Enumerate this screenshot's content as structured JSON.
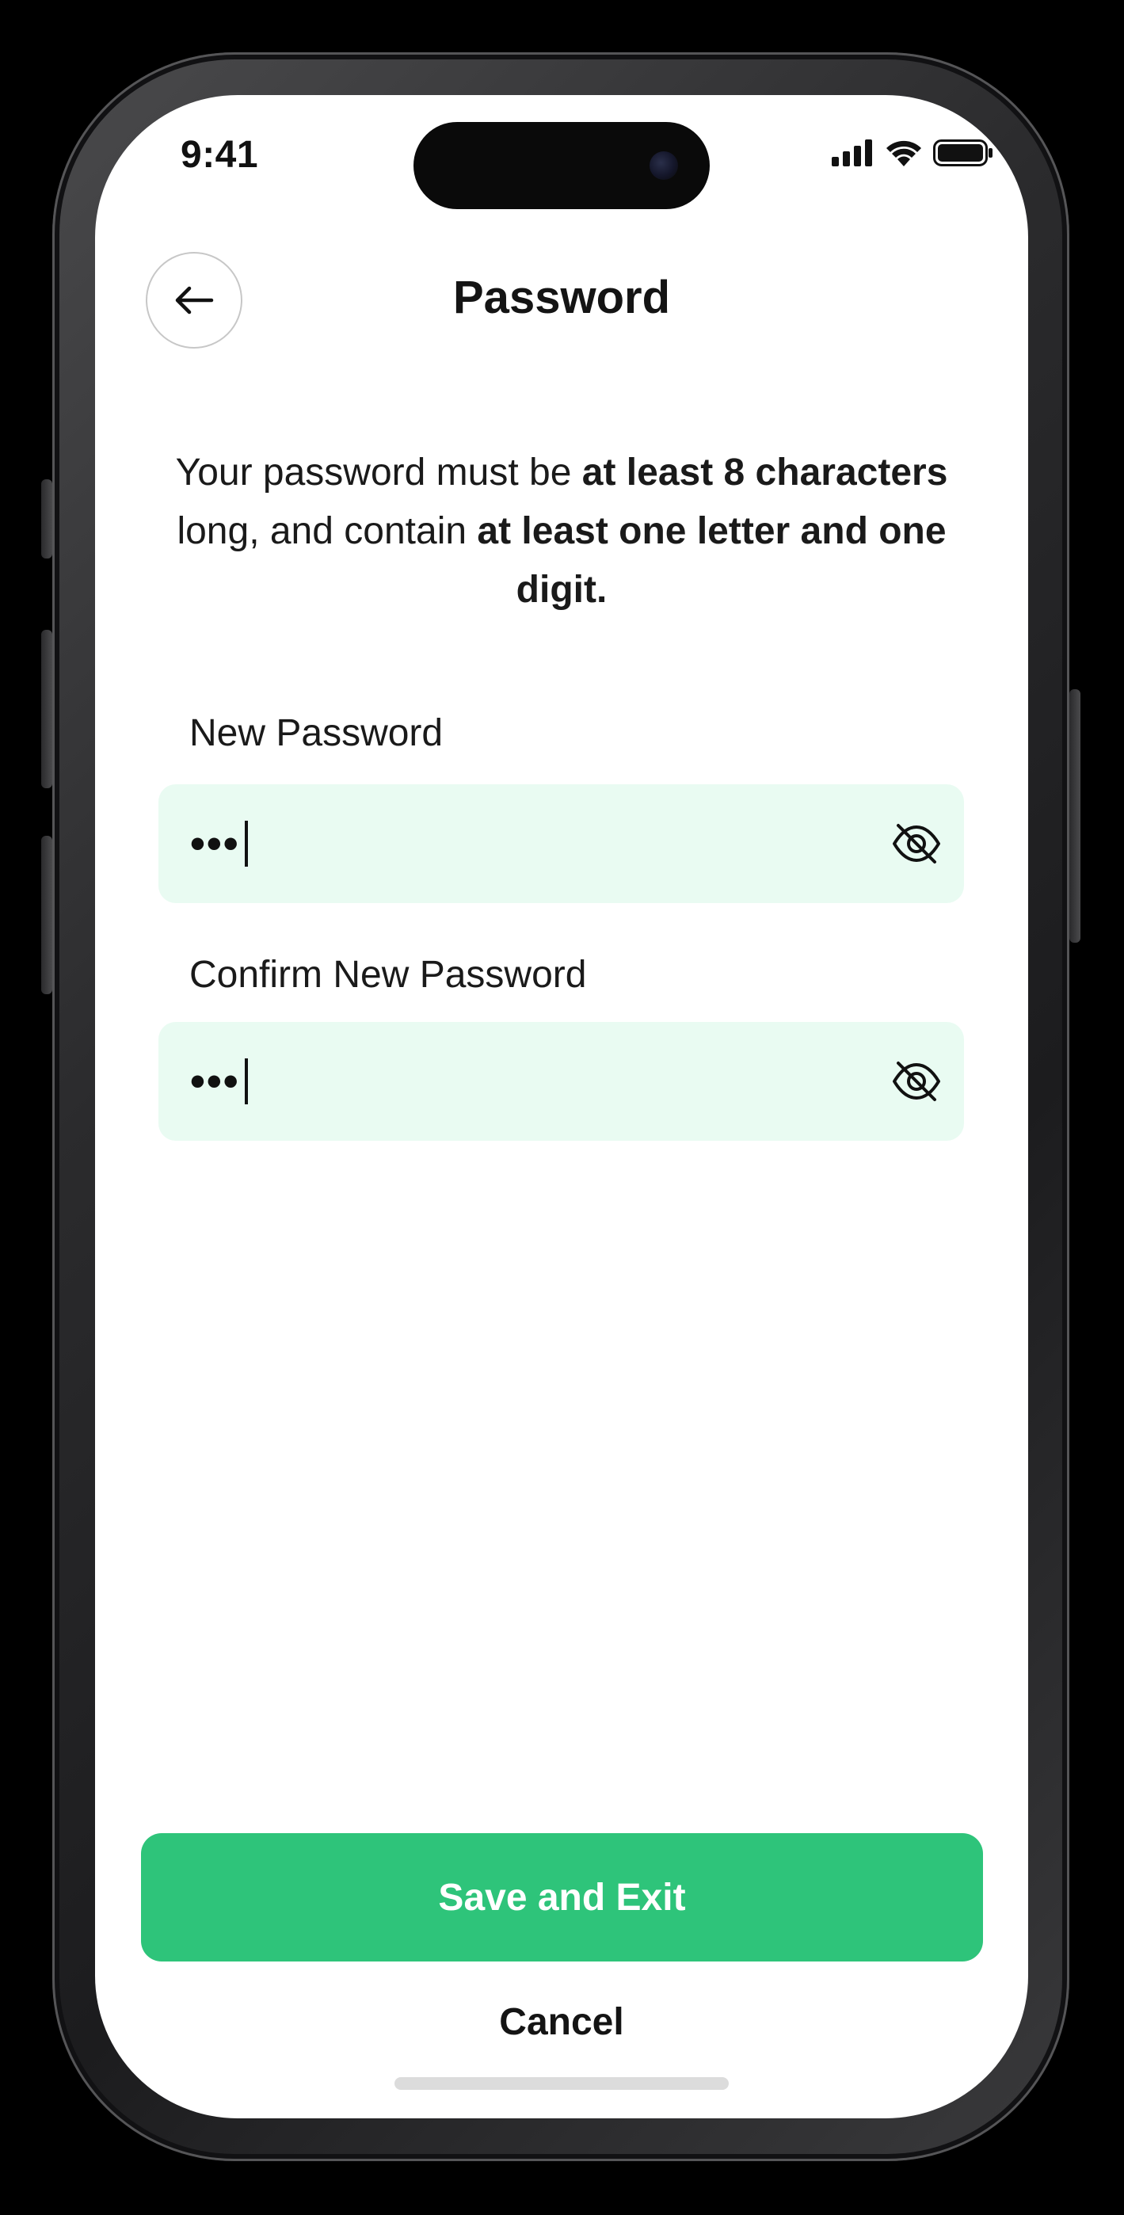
{
  "status_bar": {
    "time": "9:41",
    "icons": [
      "cellular-signal-icon",
      "wifi-icon",
      "battery-icon"
    ]
  },
  "header": {
    "back_icon": "arrow-left-icon",
    "title": "Password"
  },
  "description": {
    "part1": "Your password must be ",
    "bold1": "at least 8 characters",
    "part2": " long, and contain ",
    "bold2": "at least one letter and one digit."
  },
  "fields": {
    "new_password": {
      "label": "New Password",
      "value_masked": "•••",
      "toggle_icon": "eye-off-icon"
    },
    "confirm_password": {
      "label": "Confirm New Password",
      "value_masked": "•••",
      "toggle_icon": "eye-off-icon"
    }
  },
  "actions": {
    "save_label": "Save and Exit",
    "cancel_label": "Cancel"
  },
  "colors": {
    "accent": "#2ec47a",
    "input_background": "#e9fbf2",
    "text": "#141414",
    "background": "#ffffff"
  }
}
